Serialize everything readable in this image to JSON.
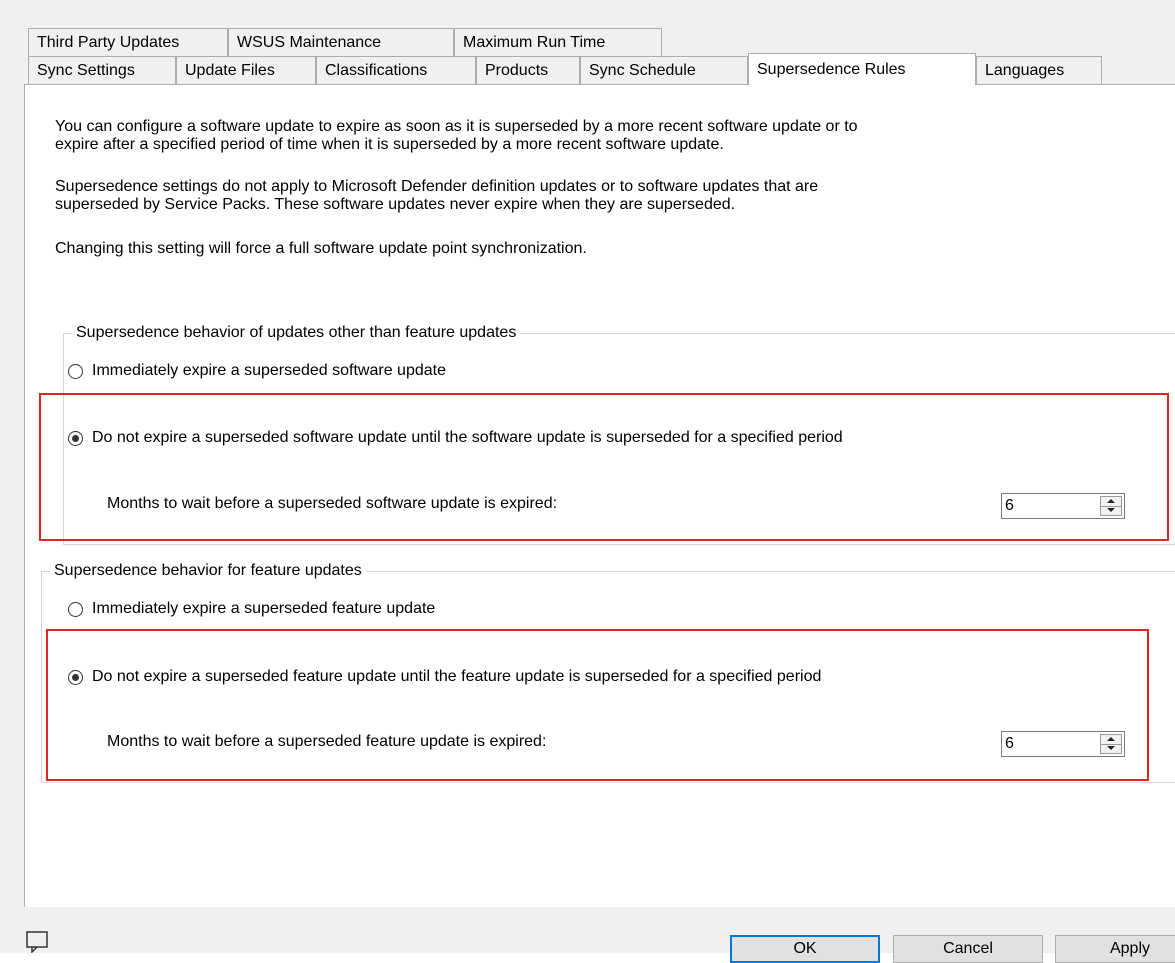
{
  "tabs_row1": [
    {
      "label": "Third Party Updates"
    },
    {
      "label": "WSUS Maintenance"
    },
    {
      "label": "Maximum Run Time"
    }
  ],
  "tabs_row2": [
    {
      "label": "Sync Settings"
    },
    {
      "label": "Update Files"
    },
    {
      "label": "Classifications"
    },
    {
      "label": "Products"
    },
    {
      "label": "Sync Schedule"
    },
    {
      "label": "Supersedence Rules",
      "active": true
    },
    {
      "label": "Languages"
    }
  ],
  "intro": {
    "p1_line1": "You can configure a software update to expire as soon as it is superseded by a more recent software update or to",
    "p1_line2": "expire after a specified period of time when it is superseded by a more recent software update.",
    "p2_line1": "Supersedence settings do not apply to Microsoft Defender definition updates or to software updates that are",
    "p2_line2": "superseded by Service Packs. These software updates never expire when they are superseded.",
    "p3": "Changing this setting will force a full software update point synchronization."
  },
  "group_other": {
    "title": "Supersedence behavior of updates other than feature updates",
    "option_immediate": "Immediately expire a superseded software update",
    "option_wait": "Do not expire a superseded software update until the software update is superseded for a specified period",
    "selected": "wait",
    "months_label": "Months to wait before a superseded software update is expired:",
    "months_value": "6"
  },
  "group_feature": {
    "title": "Supersedence behavior for feature updates",
    "option_immediate": "Immediately expire a superseded feature update",
    "option_wait": "Do not expire a superseded feature update until the feature update is superseded for a specified period",
    "selected": "wait",
    "months_label": "Months to wait before a superseded feature update is expired:",
    "months_value": "6"
  },
  "buttons": {
    "ok": "OK",
    "cancel": "Cancel",
    "apply": "Apply"
  },
  "icons": {
    "help": "help-icon"
  },
  "colors": {
    "highlight": "#e02424",
    "default_button_border": "#0078d7"
  }
}
